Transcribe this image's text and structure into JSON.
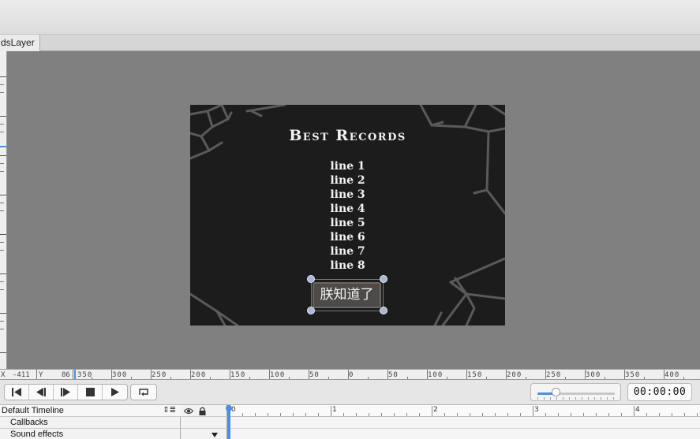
{
  "tab": {
    "label": "dsLayer"
  },
  "stage": {
    "title": "Best Records",
    "lines": [
      "line 1",
      "line 2",
      "line 3",
      "line 4",
      "line 5",
      "line 6",
      "line 7",
      "line 8"
    ],
    "button_label": "朕知道了"
  },
  "hruler": {
    "x_label": "X",
    "x_value": "-411",
    "y_label": "Y",
    "y_value": "86",
    "ticks": [
      "350",
      "300",
      "250",
      "200",
      "150",
      "100",
      "50",
      "0",
      "50",
      "100",
      "150",
      "200",
      "250",
      "300",
      "350",
      "400"
    ]
  },
  "controls": {
    "time": "00:00:00",
    "zoom_fraction": 0.23
  },
  "timeline": {
    "name": "Default Timeline",
    "rows": [
      "Callbacks",
      "Sound effects"
    ],
    "ruler_labels": [
      "0",
      "1",
      "2",
      "3",
      "4"
    ]
  },
  "colors": {
    "canvas_bg": "#808080",
    "stage_bg": "#1c1c1c",
    "accent": "#4a90e2"
  }
}
